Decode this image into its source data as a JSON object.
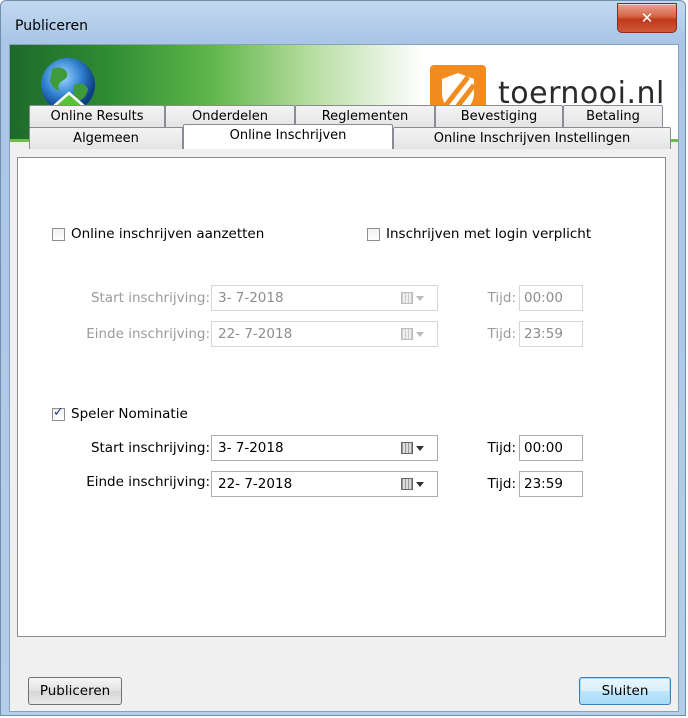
{
  "window": {
    "title": "Publiceren",
    "close_glyph": "✕"
  },
  "banner": {
    "logo_text": "toernooi.nl",
    "logo_color": "#f28c1e"
  },
  "tabs": {
    "row1": [
      "Online Results",
      "Onderdelen",
      "Reglementen",
      "Bevestiging",
      "Betaling"
    ],
    "row2": [
      "Algemeen",
      "Online Inschrijven",
      "Online Inschrijven Instellingen"
    ],
    "active": "Online Inschrijven"
  },
  "online": {
    "enable_label": "Online inschrijven aanzetten",
    "enable_checked": false,
    "login_label": "Inschrijven met login verplicht",
    "login_checked": false,
    "start_label": "Start inschrijving:",
    "start_date": "3-  7-2018",
    "start_time_label": "Tijd:",
    "start_time": "00:00",
    "end_label": "Einde inschrijving:",
    "end_date": "22-  7-2018",
    "end_time_label": "Tijd:",
    "end_time": "23:59"
  },
  "nomination": {
    "label": "Speler Nominatie",
    "checked": true,
    "start_label": "Start inschrijving:",
    "start_date": "3-  7-2018",
    "start_time_label": "Tijd:",
    "start_time": "00:00",
    "end_label": "Einde inschrijving:",
    "end_date": "22-  7-2018",
    "end_time_label": "Tijd:",
    "end_time": "23:59"
  },
  "buttons": {
    "publish": "Publiceren",
    "close": "Sluiten"
  }
}
